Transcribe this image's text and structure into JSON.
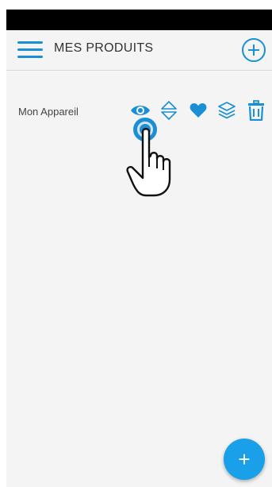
{
  "header": {
    "title": "MES PRODUITS"
  },
  "product": {
    "name": "Mon Appareil"
  },
  "icons": {
    "menu": "hamburger-menu-icon",
    "add": "plus-circle-icon",
    "view": "eye-icon",
    "sort": "sort-icon",
    "favorite": "heart-icon",
    "layers": "layers-icon",
    "delete": "trash-icon",
    "fab": "plus-icon"
  },
  "fab": {
    "label": "+"
  },
  "colors": {
    "accent": "#1a8fd6",
    "fab": "#1aa0e8",
    "background": "#f4f4f4"
  }
}
